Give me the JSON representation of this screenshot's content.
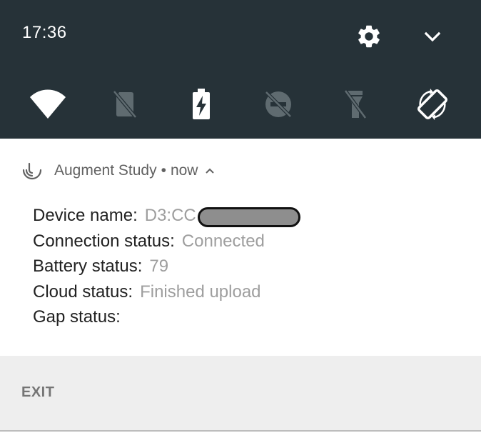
{
  "status_bar": {
    "time": "17:36",
    "settings_icon": "gear-icon",
    "expand_icon": "chevron-down-icon"
  },
  "quick_settings": {
    "tiles": [
      {
        "name": "wifi",
        "icon": "wifi-icon",
        "state": "on"
      },
      {
        "name": "no-sim",
        "icon": "sim-card-off-icon",
        "state": "off"
      },
      {
        "name": "battery-saver",
        "icon": "battery-charging-icon",
        "state": "on"
      },
      {
        "name": "do-not-disturb",
        "icon": "do-not-disturb-off-icon",
        "state": "off"
      },
      {
        "name": "flashlight",
        "icon": "flashlight-off-icon",
        "state": "off"
      },
      {
        "name": "auto-rotate",
        "icon": "screen-rotation-icon",
        "state": "on"
      }
    ]
  },
  "notification": {
    "app_name": "Augment Study",
    "separator": "•",
    "when": "now",
    "lines": [
      {
        "label": "Device name:",
        "value": "D3:CC",
        "redacted": true
      },
      {
        "label": "Connection status:",
        "value": "Connected"
      },
      {
        "label": "Battery status:",
        "value": "79"
      },
      {
        "label": "Cloud status:",
        "value": "Finished upload"
      },
      {
        "label": "Gap status:",
        "value": ""
      }
    ],
    "actions": {
      "exit_label": "EXIT"
    }
  },
  "colors": {
    "shade_background": "#263238",
    "label_text": "#212121",
    "value_text": "#9e9e9e",
    "action_bar": "#eeeeee"
  }
}
